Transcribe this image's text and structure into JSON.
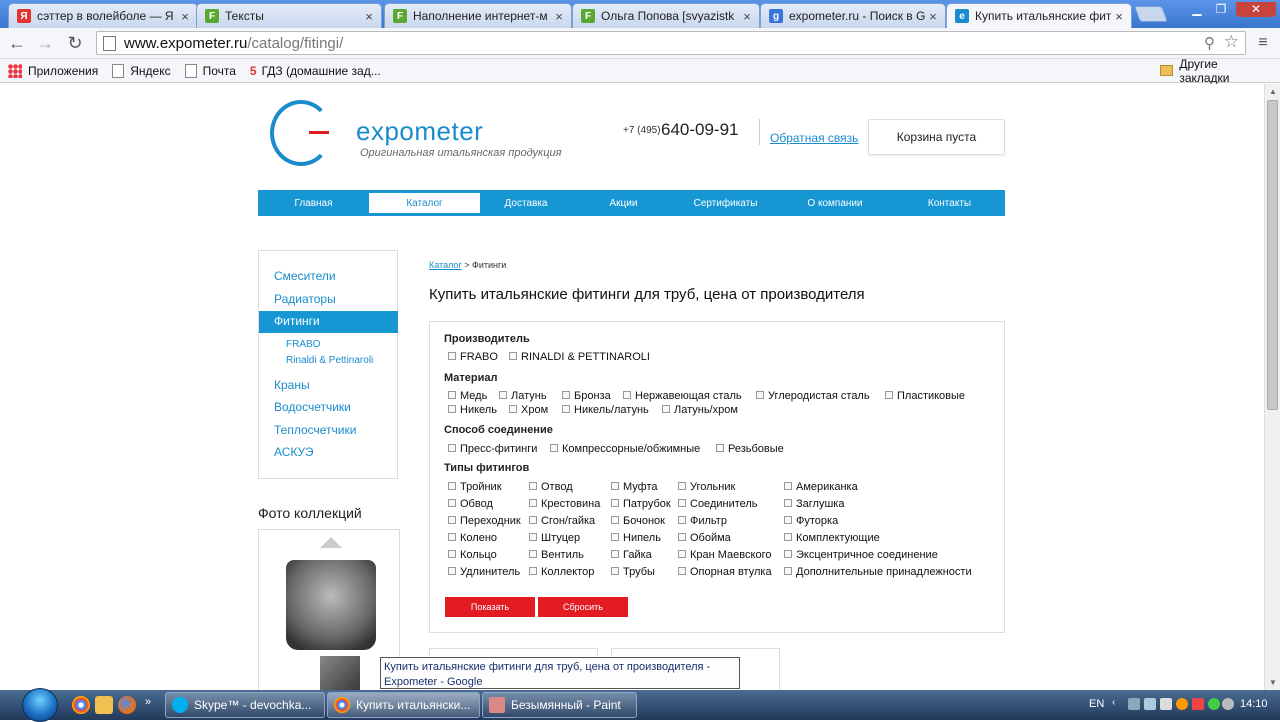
{
  "browser": {
    "tabs": [
      {
        "title": "сэттер в волейболе — Я",
        "favicon": "Я",
        "color": "#e3342f"
      },
      {
        "title": "Тексты",
        "favicon": "F",
        "color": "#5aa832"
      },
      {
        "title": "Наполнение интернет-м",
        "favicon": "F",
        "color": "#5aa832"
      },
      {
        "title": "Ольга Попова [svyazistk",
        "favicon": "F",
        "color": "#5aa832"
      },
      {
        "title": "expometer.ru - Поиск в G",
        "favicon": "g",
        "color": "#3b73d8"
      },
      {
        "title": "Купить итальянские фит",
        "favicon": "e",
        "color": "#1a8ccd"
      }
    ],
    "url_host": "www.expometer.ru",
    "url_path": "/catalog/fitingi/",
    "bookmarks": [
      "Приложения",
      "Яндекс",
      "Почта",
      "ГДЗ (домашние зад..."
    ],
    "other_bookmarks": "Другие закладки"
  },
  "site": {
    "logo": "expometer",
    "tagline": "Оригинальная итальянская продукция",
    "phone_prefix": "+7 (495)",
    "phone": "640-09-91",
    "feedback": "Обратная связь",
    "cart": "Корзина пуста",
    "nav": [
      "Главная",
      "Каталог",
      "Доставка",
      "Акции",
      "Сертификаты",
      "О компании",
      "Контакты"
    ],
    "nav_active": "Каталог"
  },
  "sidebar": {
    "items": [
      "Смесители",
      "Радиаторы",
      "Фитинги"
    ],
    "subitems": [
      "FRABO",
      "Rinaldi & Pettinaroli"
    ],
    "items_after": [
      "Краны",
      "Водосчетчики",
      "Теплосчетчики",
      "АСКУЭ"
    ],
    "photo_title": "Фото коллекций"
  },
  "content": {
    "breadcrumb_link": "Каталог",
    "breadcrumb_sep": ">",
    "breadcrumb_current": "Фитинги",
    "title": "Купить итальянские фитинги для труб, цена от производителя",
    "groups": {
      "manufacturer": {
        "label": "Производитель",
        "options": [
          "FRABO",
          "RINALDI & PETTINAROLI"
        ]
      },
      "material": {
        "label": "Материал",
        "row1": [
          "Медь",
          "Латунь",
          "Бронза",
          "Нержавеющая сталь",
          "Углеродистая сталь",
          "Пластиковые"
        ],
        "row2": [
          "Никель",
          "Хром",
          "Никель/латунь",
          "Латунь/хром"
        ]
      },
      "connection": {
        "label": "Способ соединение",
        "options": [
          "Пресс-фитинги",
          "Компрессорные/обжимные",
          "Резьбовые"
        ]
      },
      "types": {
        "label": "Типы фитингов",
        "columns": [
          [
            "Тройник",
            "Обвод",
            "Переходник",
            "Колено",
            "Кольцо",
            "Удлинитель"
          ],
          [
            "Отвод",
            "Крестовина",
            "Сгон/гайка",
            "Штуцер",
            "Вентиль",
            "Коллектор"
          ],
          [
            "Муфта",
            "Патрубок",
            "Бочонок",
            "Нипель",
            "Гайка",
            "Трубы"
          ],
          [
            "Угольник",
            "Соединитель",
            "Фильтр",
            "Обойма",
            "Кран Маевского",
            "Опорная втулка"
          ],
          [
            "Американка",
            "Заглушка",
            "Футорка",
            "Комплектующие",
            "Эксцентричное соединение",
            "Дополнительные принадлежности"
          ]
        ]
      }
    },
    "show_button": "Показать",
    "reset_button": "Сбросить",
    "tooltip": "Купить итальянские фитинги для труб, цена от производителя - Expometer - Google"
  },
  "taskbar": {
    "tasks": [
      "Skype™ - devochka...",
      "Купить итальянски...",
      "Безымянный - Paint"
    ],
    "lang": "EN",
    "time": "14:10"
  },
  "colors": {
    "accent": "#1796d4",
    "button": "#e31b23"
  }
}
